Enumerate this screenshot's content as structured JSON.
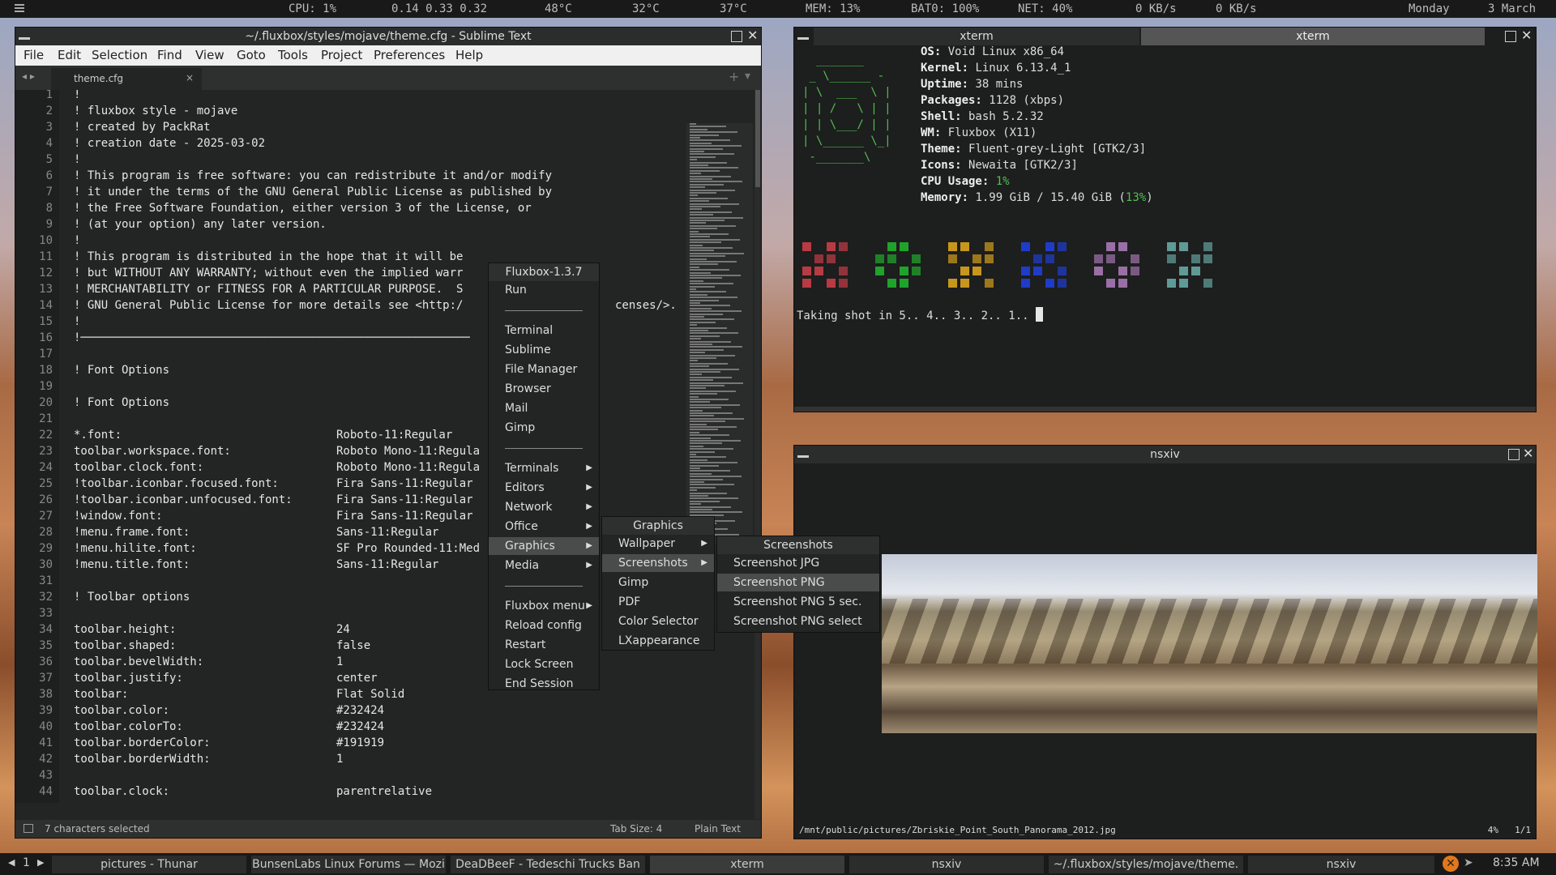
{
  "topbar": {
    "cpu": "CPU:  1%",
    "load": "0.14 0.33 0.32",
    "t1": "48°C",
    "t2": "32°C",
    "t3": "37°C",
    "mem": "MEM: 13%",
    "bat": "BAT0:  100%",
    "net": "NET:  40%",
    "rx": "0 KB/s",
    "tx": "0 KB/s",
    "day": "Monday",
    "date": "3 March"
  },
  "sublime": {
    "title": "~/.fluxbox/styles/mojave/theme.cfg - Sublime Text",
    "menus": [
      "File",
      "Edit",
      "Selection",
      "Find",
      "View",
      "Goto",
      "Tools",
      "Project",
      "Preferences",
      "Help"
    ],
    "tab": "theme.cfg",
    "tab_close": "×",
    "tab_plus": "+",
    "tab_arrow": "▾",
    "tab_nav": "◂ ▸",
    "lines": [
      {
        "n": "1",
        "t": "!"
      },
      {
        "n": "2",
        "t": "! fluxbox style - mojave"
      },
      {
        "n": "3",
        "t": "! created by PackRat"
      },
      {
        "n": "4",
        "t": "! creation date - 2025-03-02"
      },
      {
        "n": "5",
        "t": "!"
      },
      {
        "n": "6",
        "t": "! This program is free software: you can redistribute it and/or modify"
      },
      {
        "n": "7",
        "t": "! it under the terms of the GNU General Public License as published by"
      },
      {
        "n": "8",
        "t": "! the Free Software Foundation, either version 3 of the License, or"
      },
      {
        "n": "9",
        "t": "! (at your option) any later version."
      },
      {
        "n": "10",
        "t": "!"
      },
      {
        "n": "11",
        "t": "! This program is distributed in the hope that it will be"
      },
      {
        "n": "12",
        "t": "! but WITHOUT ANY WARRANTY; without even the implied warr"
      },
      {
        "n": "13",
        "t": "! MERCHANTABILITY or FITNESS FOR A PARTICULAR PURPOSE.  S"
      },
      {
        "n": "14",
        "t": "! GNU General Public License for more details see <http:/"
      },
      {
        "n": "15",
        "t": "!"
      },
      {
        "n": "16",
        "t": "!─────────────────────────────────────────────────────────"
      },
      {
        "n": "17",
        "t": ""
      },
      {
        "n": "18",
        "t": "! Font Options"
      },
      {
        "n": "19",
        "t": ""
      },
      {
        "n": "20",
        "t": "! Font Options"
      },
      {
        "n": "21",
        "t": ""
      },
      {
        "n": "22",
        "t": "*.font:",
        "v": "Roboto-11:Regular"
      },
      {
        "n": "23",
        "t": "toolbar.workspace.font:",
        "v": "Roboto Mono-11:Regula"
      },
      {
        "n": "24",
        "t": "toolbar.clock.font:",
        "v": "Roboto Mono-11:Regula"
      },
      {
        "n": "25",
        "t": "!toolbar.iconbar.focused.font:",
        "v": "Fira Sans-11:Regular"
      },
      {
        "n": "26",
        "t": "!toolbar.iconbar.unfocused.font:",
        "v": "Fira Sans-11:Regular"
      },
      {
        "n": "27",
        "t": "!window.font:",
        "v": "Fira Sans-11:Regular"
      },
      {
        "n": "28",
        "t": "!menu.frame.font:",
        "v": "Sans-11:Regular"
      },
      {
        "n": "29",
        "t": "!menu.hilite.font:",
        "v": "SF Pro Rounded-11:Med"
      },
      {
        "n": "30",
        "t": "!menu.title.font:",
        "v": "Sans-11:Regular"
      },
      {
        "n": "31",
        "t": ""
      },
      {
        "n": "32",
        "t": "! Toolbar options"
      },
      {
        "n": "33",
        "t": ""
      },
      {
        "n": "34",
        "t": "toolbar.height:",
        "v": "24"
      },
      {
        "n": "35",
        "t": "toolbar.shaped:",
        "v": "false"
      },
      {
        "n": "36",
        "t": "toolbar.bevelWidth:",
        "v": "1"
      },
      {
        "n": "37",
        "t": "toolbar.justify:",
        "v": "center"
      },
      {
        "n": "38",
        "t": "toolbar:",
        "v": "Flat Solid"
      },
      {
        "n": "39",
        "t": "toolbar.color:",
        "v": "#232424"
      },
      {
        "n": "40",
        "t": "toolbar.colorTo:",
        "v": "#232424"
      },
      {
        "n": "41",
        "t": "toolbar.borderColor:",
        "v": "#191919"
      },
      {
        "n": "42",
        "t": "toolbar.borderWidth:",
        "v": "1"
      },
      {
        "n": "43",
        "t": ""
      },
      {
        "n": "44",
        "t": "toolbar.clock:",
        "v": "parentrelative"
      }
    ],
    "line14_tail": "censes/>.",
    "status_selected": "7 characters selected",
    "status_tab": "Tab Size: 4",
    "status_syntax": "Plain Text"
  },
  "xterm": {
    "tab1": "xterm",
    "tab2": "xterm",
    "art": "  _______\n _ \\______ -\n| \\  ___  \\ |\n| | /   \\ | |\n| | \\___/ | |\n| \\______ \\_|\n -_______\\",
    "info": [
      {
        "k": "OS:",
        "v": " Void Linux x86_64"
      },
      {
        "k": "Kernel:",
        "v": " Linux 6.13.4_1"
      },
      {
        "k": "Uptime:",
        "v": " 38 mins"
      },
      {
        "k": "Packages:",
        "v": " 1128 (xbps)"
      },
      {
        "k": "Shell:",
        "v": " bash 5.2.32"
      },
      {
        "k": "WM:",
        "v": " Fluxbox (X11)"
      },
      {
        "k": "Theme:",
        "v": " Fluent-grey-Light [GTK2/3]"
      },
      {
        "k": "Icons:",
        "v": " Newaita [GTK2/3]"
      },
      {
        "k": "CPU Usage:",
        "v": " ",
        "g": "1%"
      },
      {
        "k": "Memory:",
        "v": " 1.99 GiB / 15.40 GiB (",
        "g": "13%",
        "e": ")"
      }
    ],
    "prompt": "Taking shot in 5.. 4.. 3.. 2.. 1.. ",
    "palette": [
      "#b83b44",
      "#1fa32b",
      "#c8961c",
      "#1f3cc8",
      "#9a6fa6",
      "#5f9b96"
    ]
  },
  "nsxiv": {
    "title": "nsxiv",
    "path": "/mnt/public/pictures/Zbriskie_Point_South_Panorama_2012.jpg",
    "zoom": "4%",
    "count": "1/1"
  },
  "menu_root": {
    "title": "Fluxbox-1.3.7",
    "items": [
      "Run",
      "Terminal",
      "Sublime",
      "File Manager",
      "Browser",
      "Mail",
      "Gimp",
      "Terminals",
      "Editors",
      "Network",
      "Office",
      "Graphics",
      "Media",
      "Fluxbox menu",
      "Reload config",
      "Restart",
      "Lock Screen",
      "End Session"
    ]
  },
  "menu_graphics": {
    "title": "Graphics",
    "items": [
      "Wallpaper",
      "Screenshots",
      "Gimp",
      "PDF",
      "Color Selector",
      "LXappearance"
    ]
  },
  "menu_screenshots": {
    "title": "Screenshots",
    "items": [
      "Screenshot JPG",
      "Screenshot PNG",
      "Screenshot PNG 5 sec.",
      "Screenshot PNG select"
    ]
  },
  "taskbar": {
    "workspace": "1",
    "tasks": [
      "pictures - Thunar",
      "BunsenLabs Linux Forums — Mozi",
      "DeaDBeeF - Tedeschi Trucks Ban",
      "xterm",
      "nsxiv",
      "~/.fluxbox/styles/mojave/theme.",
      "nsxiv"
    ],
    "clock": "8:35 AM"
  }
}
